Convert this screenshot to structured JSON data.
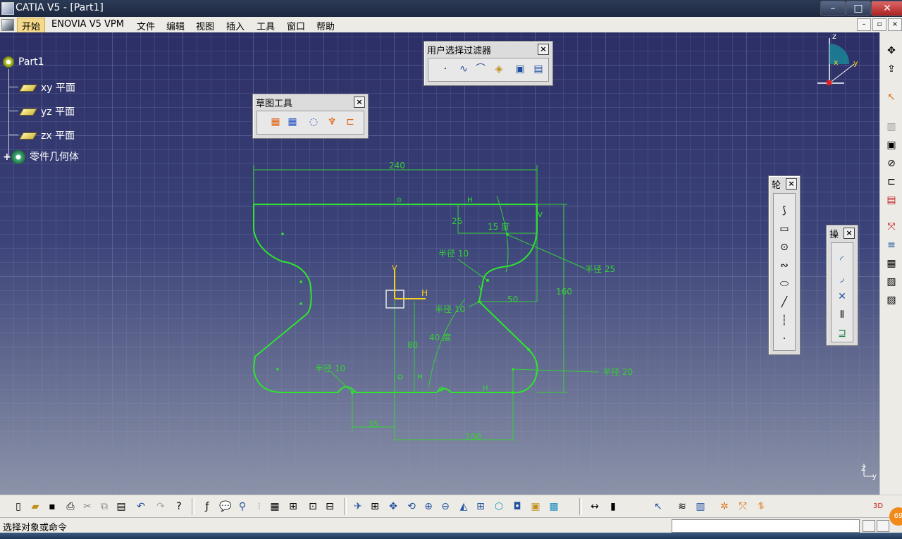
{
  "window": {
    "title": "CATIA V5 - [Part1]",
    "min": "–",
    "max": "□",
    "close": "✕"
  },
  "menu": {
    "items": [
      "开始",
      "ENOVIA V5 VPM",
      "文件",
      "编辑",
      "视图",
      "插入",
      "工具",
      "窗口",
      "帮助"
    ],
    "mdi": [
      "–",
      "▫",
      "×"
    ]
  },
  "tree": {
    "root": "Part1",
    "children": [
      "xy 平面",
      "yz 平面",
      "zx 平面",
      "零件几何体"
    ]
  },
  "toolbars": {
    "filter": {
      "title": "用户选择过滤器",
      "close": "×"
    },
    "sketch_tools": {
      "title": "草图工具",
      "close": "×"
    },
    "profile": {
      "title": "轮",
      "close": "×"
    },
    "operation": {
      "title": "操",
      "close": "×"
    }
  },
  "sketch": {
    "dim_240": "240",
    "dim_25": "25",
    "dim_15deg": "15 度",
    "dim_r10_top": "半径 10",
    "dim_r25": "半径 25",
    "dim_160": "160",
    "dim_50": "50",
    "dim_r10_mid": "半径 10",
    "dim_r10_mid2": "半径 10",
    "dim_80": "80",
    "dim_40deg": "40 度",
    "dim_r10_bot": "半径 10",
    "dim_r20": "半径 20",
    "dim_35": "35",
    "dim_100": "100",
    "axis_h": "H",
    "axis_v": "V",
    "con_h1": "H",
    "con_h2": "H",
    "con_h3": "H",
    "con_v1": "V",
    "con_v2": "V",
    "con_o": "⊙"
  },
  "compass": {
    "z": "z",
    "x": "x",
    "y": "y"
  },
  "corner_axis": {
    "z": "Z",
    "y": "y"
  },
  "status": {
    "message": "选择对象或命令"
  },
  "badge": "69",
  "colors": {
    "sketch": "#2de62d",
    "dimension": "#35d035",
    "axis": "#f5d021"
  }
}
